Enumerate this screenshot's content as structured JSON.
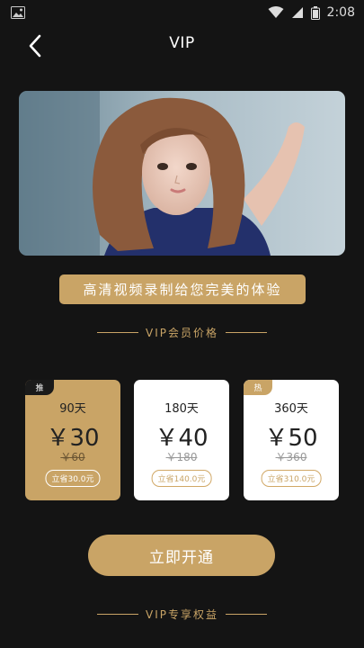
{
  "status_bar": {
    "time": "2:08"
  },
  "header": {
    "title": "VIP"
  },
  "promo": {
    "text": "高清视频录制给您完美的体验"
  },
  "pricing_section": {
    "heading": "VIP会员价格"
  },
  "plans": [
    {
      "tag": "推",
      "duration": "90天",
      "price": "￥30",
      "original": "￥60",
      "save": "立省30.0元",
      "selected": true
    },
    {
      "tag": "",
      "duration": "180天",
      "price": "￥40",
      "original": "￥180",
      "save": "立省140.0元",
      "selected": false
    },
    {
      "tag": "热",
      "duration": "360天",
      "price": "￥50",
      "original": "￥360",
      "save": "立省310.0元",
      "selected": false
    }
  ],
  "cta": {
    "label": "立即开通"
  },
  "benefits_section": {
    "heading": "VIP专享权益"
  },
  "colors": {
    "accent": "#c9a466",
    "background": "#141414"
  }
}
